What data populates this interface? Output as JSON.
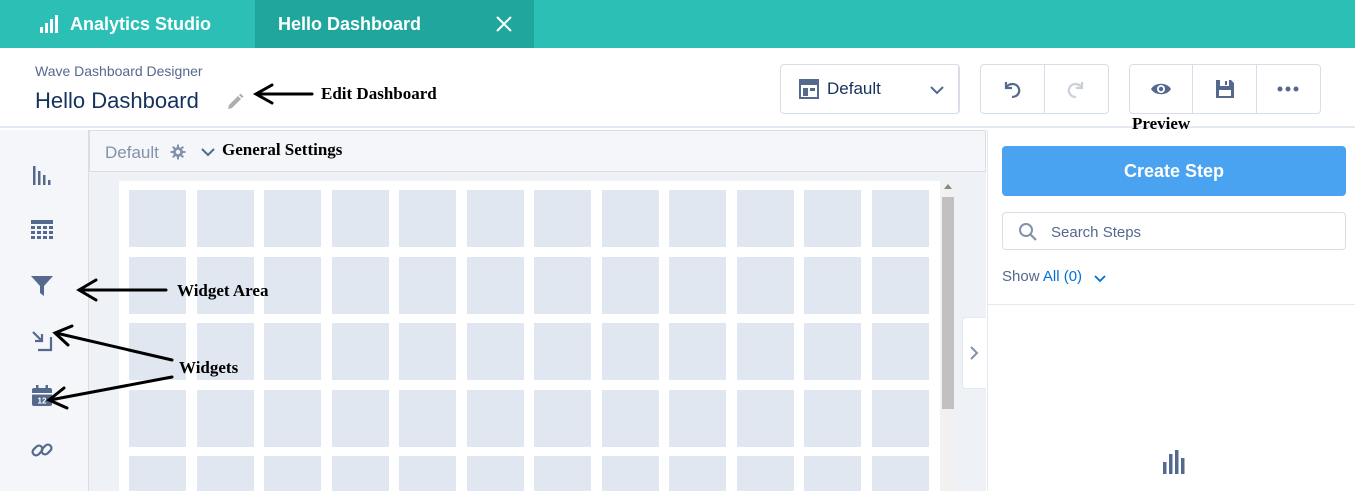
{
  "topbar": {
    "app_name": "Analytics Studio",
    "tab_title": "Hello Dashboard"
  },
  "header": {
    "subtitle": "Wave Dashboard Designer",
    "title": "Hello Dashboard",
    "layout_select_value": "Default"
  },
  "canvas": {
    "layout_name": "Default"
  },
  "right_panel": {
    "create_step_label": "Create Step",
    "search_placeholder": "Search Steps",
    "show_label": "Show",
    "show_filter": "All (0)"
  },
  "rail": {
    "items": [
      "chart-icon",
      "table-icon",
      "filter-icon",
      "number-icon",
      "date-icon",
      "link-icon"
    ]
  },
  "annotations": {
    "edit_dashboard": "Edit Dashboard",
    "general_settings": "General Settings",
    "preview": "Preview",
    "widget_area": "Widget Area",
    "widgets": "Widgets"
  },
  "colors": {
    "topbar": "#2cbfb5",
    "active_tab": "#20a69d",
    "primary_button": "#4aa3f0",
    "grid_cell": "#e0e7f1"
  }
}
